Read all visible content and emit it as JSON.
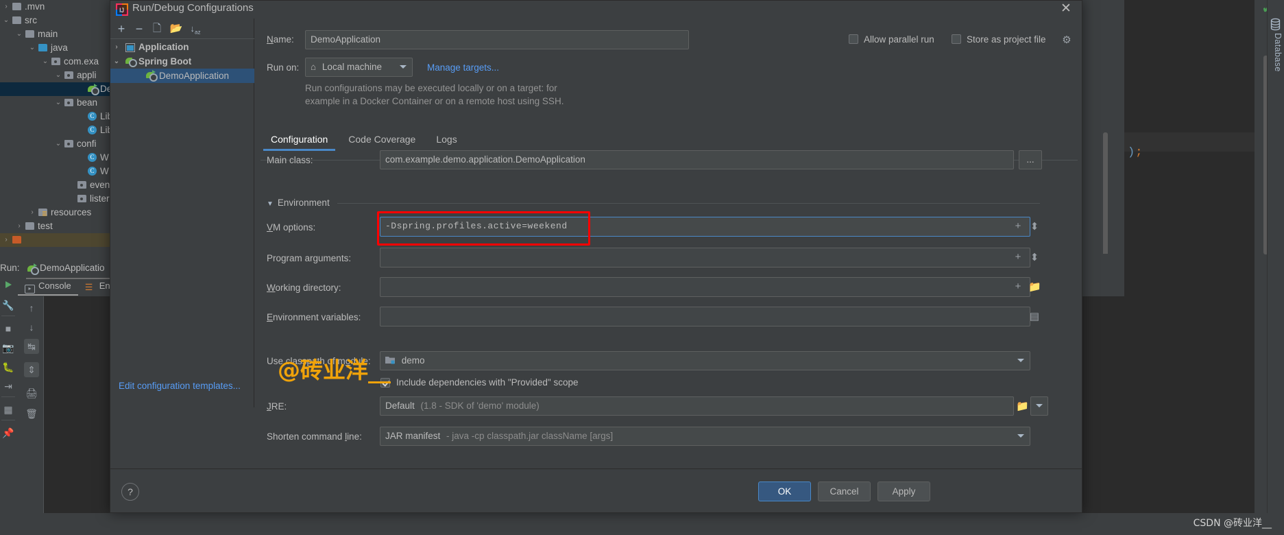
{
  "ide": {
    "project_tree": [
      {
        "label": ".mvn",
        "indent": 18,
        "arrow": "›",
        "icon": "folder"
      },
      {
        "label": "src",
        "indent": 18,
        "arrow": "⌄",
        "icon": "folder"
      },
      {
        "label": "main",
        "indent": 37,
        "arrow": "⌄",
        "icon": "folder"
      },
      {
        "label": "java",
        "indent": 56,
        "arrow": "⌄",
        "icon": "folder-blue"
      },
      {
        "label": "com.exa",
        "indent": 75,
        "arrow": "⌄",
        "icon": "folder-pkg"
      },
      {
        "label": "appli",
        "indent": 94,
        "arrow": "⌄",
        "icon": "folder-pkg"
      },
      {
        "label": "De",
        "indent": 128,
        "arrow": "",
        "icon": "spring-run",
        "selected": true
      },
      {
        "label": "bean",
        "indent": 94,
        "arrow": "⌄",
        "icon": "folder-pkg"
      },
      {
        "label": "Lib",
        "indent": 128,
        "arrow": "",
        "icon": "class"
      },
      {
        "label": "Lib",
        "indent": 128,
        "arrow": "",
        "icon": "class"
      },
      {
        "label": "confi",
        "indent": 94,
        "arrow": "⌄",
        "icon": "folder-pkg"
      },
      {
        "label": "W",
        "indent": 128,
        "arrow": "",
        "icon": "class"
      },
      {
        "label": "W",
        "indent": 128,
        "arrow": "",
        "icon": "class"
      },
      {
        "label": "even",
        "indent": 113,
        "arrow": "",
        "icon": "folder-pkg"
      },
      {
        "label": "lister",
        "indent": 113,
        "arrow": "",
        "icon": "folder-pkg"
      },
      {
        "label": "resources",
        "indent": 56,
        "arrow": "›",
        "icon": "folder-res"
      },
      {
        "label": "test",
        "indent": 37,
        "arrow": "›",
        "icon": "folder"
      },
      {
        "label": "",
        "indent": 18,
        "arrow": "›",
        "icon": "folder-brown",
        "brown": true
      }
    ],
    "editor": {
      "code_fragment": ");"
    },
    "database_tool": {
      "label": "Database",
      "icon": "database-icon"
    },
    "run_window": {
      "run_label": "Run:",
      "config_name": "DemoApplicatio",
      "tabs": [
        {
          "label": "Console",
          "icon": "console-icon",
          "active": true
        },
        {
          "label": "Endp",
          "icon": "endpoints-icon",
          "active": false
        }
      ],
      "gutter_icons": [
        "run-icon",
        "wrench-icon",
        "stop-icon",
        "camera-icon",
        "bug-icon",
        "exit-icon",
        "layout-icon",
        "pin-icon"
      ],
      "console_tool_icons": [
        "up-arrow-icon",
        "down-arrow-icon",
        "soft-wrap-icon",
        "scroll-to-end-icon",
        "print-icon",
        "trash-icon"
      ],
      "settings_icon": "gear-icon",
      "minimize_icon": "minimize-icon"
    }
  },
  "dialog": {
    "title": "Run/Debug Configurations",
    "title_icon": "intellij-idea-icon",
    "close_icon": "close-icon",
    "toolbar": [
      {
        "icon": "add-icon",
        "glyph": "+"
      },
      {
        "icon": "remove-icon",
        "glyph": "−"
      },
      {
        "icon": "copy-icon",
        "glyph": "⎘"
      },
      {
        "icon": "folder-add-icon",
        "glyph": "▤"
      },
      {
        "icon": "sort-icon",
        "glyph": "↓"
      }
    ],
    "config_tree": [
      {
        "label": "Application",
        "arrow": "›",
        "icon": "application-icon",
        "indent": 12,
        "group": true,
        "selected": false
      },
      {
        "label": "Spring Boot",
        "arrow": "⌄",
        "icon": "spring-icon",
        "indent": 12,
        "group": true,
        "selected": false
      },
      {
        "label": "DemoApplication",
        "arrow": "",
        "icon": "spring-run-icon",
        "indent": 42,
        "group": false,
        "selected": true
      }
    ],
    "edit_templates_link": "Edit configuration templates...",
    "form": {
      "name_label": "Name:",
      "name_label_mnemonic": "N",
      "name_value": "DemoApplication",
      "allow_parallel_run_label": "Allow parallel run",
      "allow_parallel_run_checked": false,
      "store_as_project_file_label": "Store as project file",
      "store_as_project_file_checked": false,
      "store_gear_icon": "gear-icon",
      "run_on_label": "Run on:",
      "run_on_value": "Local machine",
      "run_on_icon": "home-icon",
      "manage_targets_link": "Manage targets...",
      "hint_line1": "Run configurations may be executed locally or on a target: for",
      "hint_line2": "example in a Docker Container or on a remote host using SSH.",
      "tabs": [
        {
          "label": "Configuration",
          "active": true
        },
        {
          "label": "Code Coverage",
          "active": false
        },
        {
          "label": "Logs",
          "active": false
        }
      ],
      "main_class_label": "Main class:",
      "main_class_value": "com.example.demo.application.DemoApplication",
      "main_class_browse": "...",
      "environment_section": "Environment",
      "environment_mnemonic": "m",
      "vm_options_label": "VM options:",
      "vm_options_value": "-Dspring.profiles.active=weekend",
      "vm_options_expand_icon": "expand-icon",
      "vm_options_insert_icon": "insert-macro-icon",
      "vm_options_highlighted": true,
      "program_arguments_label": "Program arguments:",
      "program_arguments_value": "",
      "working_directory_label": "Working directory:",
      "working_directory_value": "",
      "working_directory_browse_icon": "folder-icon",
      "environment_variables_label": "Environment variables:",
      "environment_variables_value": "",
      "environment_variables_browse_icon": "edit-table-icon",
      "use_classpath_label": "Use classpath of module:",
      "use_classpath_value": "demo",
      "use_classpath_icon": "module-icon",
      "include_provided_label": "Include dependencies with \"Provided\" scope",
      "include_provided_checked": true,
      "jre_label": "JRE:",
      "jre_value": "Default",
      "jre_value_hint": "(1.8 - SDK of 'demo' module)",
      "jre_browse_icon": "folder-icon",
      "shorten_command_line_label": "Shorten command line:",
      "shorten_command_line_value": "JAR manifest",
      "shorten_command_line_hint": "- java -cp classpath.jar className [args]"
    },
    "buttons": {
      "help": "?",
      "ok": "OK",
      "cancel": "Cancel",
      "apply": "Apply"
    }
  },
  "watermarks": {
    "overlay": "@砖业洋__",
    "footer": "CSDN @砖业洋__"
  },
  "colors": {
    "accent_blue": "#4a88c7",
    "link_blue": "#589df6",
    "highlight_red": "#ff0000",
    "watermark_orange": "#f0a30a",
    "selection_blue": "#2d5177",
    "tree_selection": "#0d293e"
  }
}
